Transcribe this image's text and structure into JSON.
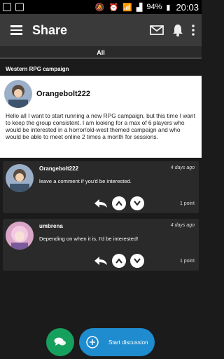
{
  "status_bar": {
    "battery": "94%",
    "time": "20:03"
  },
  "toolbar": {
    "title": "Share"
  },
  "tabs": [
    {
      "label": "All"
    }
  ],
  "section": {
    "title": "Western RPG campaign"
  },
  "post": {
    "author": "Orangebolt222",
    "body": "Hello all I want to start running a new RPG campaign, but this time I want to keep the group consistent. I am looking for a max of 6 players who would be interested in a horror/old-west themed campaign and who would be able to meet online 2 times a month for sessions."
  },
  "comments": [
    {
      "author": "Orangebolt222",
      "time": "4 days ago",
      "text": "leave a comment if you'd be interested.",
      "points": "1 point"
    },
    {
      "author": "umbrena",
      "time": "4 days ago",
      "text": "Depending on when it is, I'd be interested!",
      "points": "1 point"
    }
  ],
  "actions": {
    "start_discussion": "Start discussion"
  }
}
